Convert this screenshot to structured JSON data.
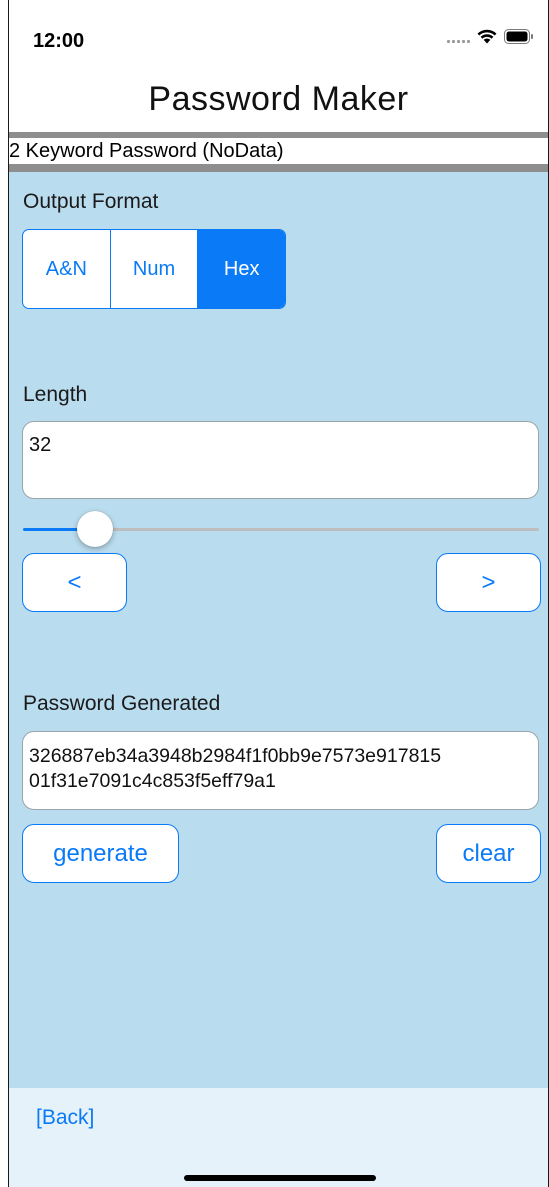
{
  "status_bar": {
    "time": "12:00",
    "icons": [
      "cellular-signal-icon",
      "wifi-icon",
      "battery-icon"
    ]
  },
  "nav": {
    "title": "Password Maker"
  },
  "mode_label": "2 Keyword Password (NoData)",
  "output_format": {
    "label": "Output Format",
    "options": [
      "A&N",
      "Num",
      "Hex"
    ],
    "selected": "Hex"
  },
  "length": {
    "label": "Length",
    "value": "32",
    "slider_fraction": 0.14,
    "decrement_label": "<",
    "increment_label": ">"
  },
  "password": {
    "label": "Password Generated",
    "line1": "326887eb34a3948b2984f1f0bb9e7573e917815",
    "line2": "01f31e7091c4c853f5eff79a1"
  },
  "actions": {
    "generate_label": "generate",
    "clear_label": "clear"
  },
  "footer": {
    "back_label": "[Back]"
  },
  "colors": {
    "accent": "#0a7af7",
    "content_background": "#b9dcee",
    "footer_background": "#e6f2f9",
    "separator": "#8e8e8e"
  }
}
